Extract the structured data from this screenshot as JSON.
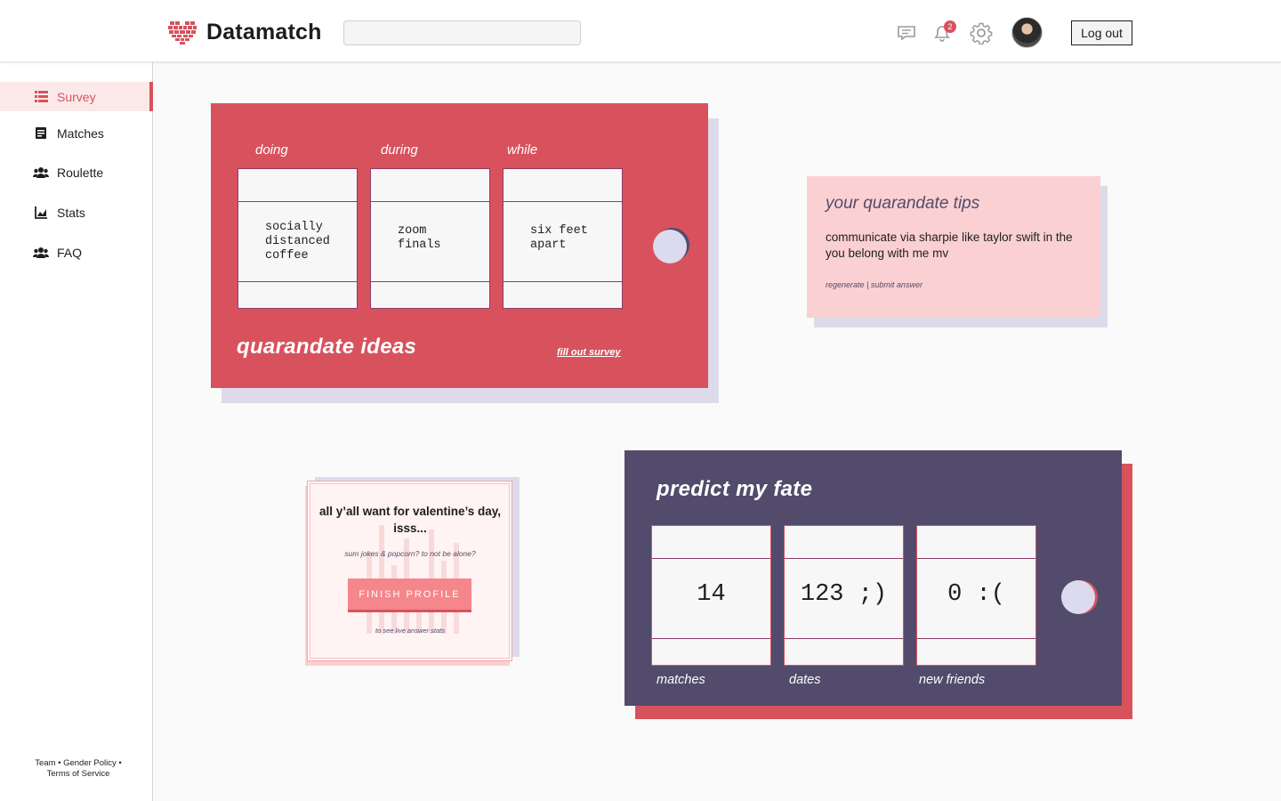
{
  "header": {
    "brand": "Datamatch",
    "search_placeholder": "",
    "notification_count": "2",
    "logout_label": "Log out",
    "icons": [
      "chat-icon",
      "bell-icon",
      "gear-icon"
    ]
  },
  "sidebar": {
    "items": [
      {
        "label": "Survey",
        "icon": "list-icon",
        "active": true
      },
      {
        "label": "Matches",
        "icon": "document-icon",
        "active": false
      },
      {
        "label": "Roulette",
        "icon": "users-icon",
        "active": false
      },
      {
        "label": "Stats",
        "icon": "chart-icon",
        "active": false
      },
      {
        "label": "FAQ",
        "icon": "users-icon",
        "active": false
      }
    ],
    "footer": {
      "team": "Team",
      "gender_policy": "Gender Policy",
      "terms": "Terms of Service"
    }
  },
  "quarandate": {
    "columns": [
      {
        "label": "doing",
        "value": "socially\ndistanced\ncoffee"
      },
      {
        "label": "during",
        "value": "zoom\nfinals"
      },
      {
        "label": "while",
        "value": "six feet\napart"
      }
    ],
    "title": "quarandate ideas",
    "link": "fill out survey"
  },
  "tips": {
    "title": "your quarandate tips",
    "text": "communicate via sharpie like taylor swift in the you belong with me mv",
    "regenerate": "regenerate",
    "separator": "|",
    "submit": "submit answer"
  },
  "valentine": {
    "title": "all y’all want for valentine’s day, isss...",
    "options": "sum jokes & popcorn?  to not be alone?",
    "button": "FINISH PROFILE",
    "note": "to see live answer stats"
  },
  "predict": {
    "title": "predict my fate",
    "slots": [
      {
        "value": "14",
        "label": "matches"
      },
      {
        "value": "123 ;)",
        "label": "dates"
      },
      {
        "value": "0 :(",
        "label": "new friends"
      }
    ]
  },
  "colors": {
    "accent": "#d8525d",
    "purple": "#524b6c",
    "pink": "#fbd0d2",
    "lavender": "#dddbeb"
  }
}
